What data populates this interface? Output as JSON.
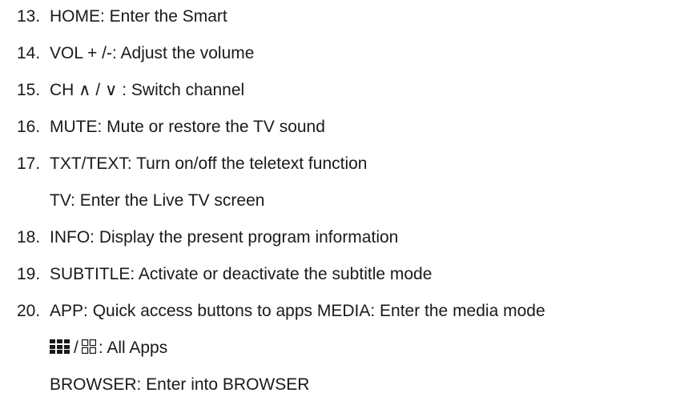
{
  "items": [
    {
      "number": "13.",
      "text": "HOME: Enter the Smart"
    },
    {
      "number": "14.",
      "text": "VOL + /-: Adjust the volume"
    },
    {
      "number": "15.",
      "text": "CH  ∧ /  ∨  : Switch channel"
    },
    {
      "number": "16.",
      "text": "MUTE: Mute or restore the TV sound"
    },
    {
      "number": "17.",
      "text": "TXT/TEXT: Turn on/off the teletext function"
    },
    {
      "number": "",
      "text": "TV: Enter the Live TV screen"
    },
    {
      "number": "18.",
      "text": "INFO: Display the present program information"
    },
    {
      "number": "19.",
      "text": "SUBTITLE: Activate or deactivate the subtitle mode"
    },
    {
      "number": "20.",
      "text": "APP: Quick access buttons to apps MEDIA: Enter the media mode"
    },
    {
      "number": "",
      "text": ": All Apps"
    },
    {
      "number": "",
      "text": "BROWSER: Enter into BROWSER"
    }
  ],
  "icons": {
    "all_apps_filled": "grid-filled-icon",
    "all_apps_outline": "grid-outline-icon",
    "separator": "/"
  }
}
